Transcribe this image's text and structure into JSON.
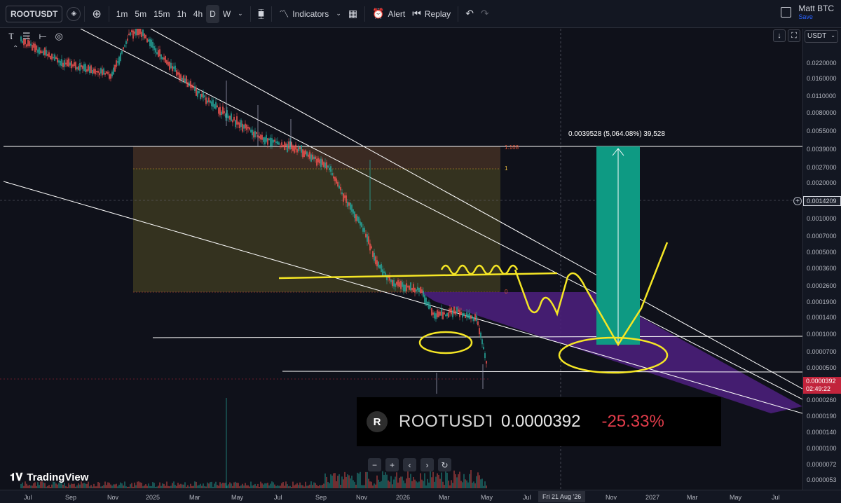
{
  "toolbar": {
    "symbol": "ROOTUSDT",
    "intervals": [
      "1m",
      "5m",
      "15m",
      "1h",
      "4h",
      "D",
      "W"
    ],
    "active_interval": "D",
    "indicators_label": "Indicators",
    "alert_label": "Alert",
    "replay_label": "Replay",
    "user_name": "Matt BTC",
    "save_label": "Save"
  },
  "price_axis": {
    "currency": "USDT",
    "ticks": [
      "0.0220000",
      "0.0160000",
      "0.0110000",
      "0.0080000",
      "0.0055000",
      "0.0039000",
      "0.0027000",
      "0.0020000",
      "0.0010000",
      "0.0007000",
      "0.0005000",
      "0.0003600",
      "0.0002600",
      "0.0001900",
      "0.0001400",
      "0.0001000",
      "0.0000700",
      "0.0000500",
      "0.0000260",
      "0.0000190",
      "0.0000140",
      "0.0000100",
      "0.0000072",
      "0.0000053"
    ],
    "crosshair_price": "0.0014209",
    "current_price": "0.0000392",
    "countdown": "02:49:22"
  },
  "time_axis": {
    "labels": [
      "Jul",
      "Sep",
      "Nov",
      "2025",
      "Mar",
      "May",
      "Jul",
      "Sep",
      "Nov",
      "2026",
      "Mar",
      "May",
      "Jul",
      "Nov",
      "2027",
      "Mar",
      "May",
      "Jul"
    ],
    "crosshair_date": "Fri 21 Aug '26"
  },
  "annotations": {
    "range_measure": "0.0039528 (5,064.08%) 39,528",
    "fib_1618": "1.168",
    "fib_1": "1",
    "fib_0": "0"
  },
  "ticker": {
    "logo_letter": "R",
    "symbol": "ROOTUSDT",
    "price": "0.0000392",
    "change": "-25.33%"
  },
  "brand": "TradingView",
  "colors": {
    "background": "#0f111a",
    "up_candle": "#26a69a",
    "down_candle": "#ef5350",
    "yellow_drawing": "#f5e625",
    "target_box": "#0e9a83",
    "wedge_fill": "#4a1f7a",
    "fib_zone": "#3a3a20"
  }
}
